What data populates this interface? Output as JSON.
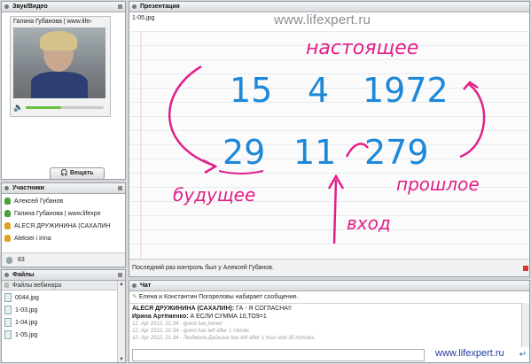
{
  "video_panel": {
    "title": "Звук/Видео",
    "speaker": "Галина Губанова | www.life›",
    "broadcast_label": "Вещать",
    "volume_level": 0.45
  },
  "presentation": {
    "title": "Презентация",
    "file": "1-05.jpg",
    "watermark": "www.lifexpert.ru",
    "status": "Последний раз контроль был у Алексей Губанов.",
    "whiteboard": {
      "nastoyashchee": "настоящее",
      "top_numbers": [
        "15",
        "4",
        "1972"
      ],
      "bottom_numbers": [
        "29",
        "11",
        "279"
      ],
      "budushchee": "будущее",
      "proshloe": "прошлое",
      "vkhod": "вход"
    }
  },
  "participants": {
    "title": "Участники",
    "items": [
      {
        "name": "Алексей Губанов",
        "color": "#4aa23c"
      },
      {
        "name": "Галина Губанова | www.lifexpe",
        "color": "#4aa23c"
      },
      {
        "name": "ALECЯ ДРУЖИНИНА (САХАЛИН",
        "color": "#e0a020"
      },
      {
        "name": "Aleksei i Irina",
        "color": "#e0a020"
      }
    ],
    "count": "83"
  },
  "files": {
    "title": "Файлы",
    "column": "Файлы вебинара",
    "items": [
      "0044.jpg",
      "1-03.jpg",
      "1-04.jpg",
      "1-05.jpg"
    ]
  },
  "chat": {
    "title": "Чат",
    "typing": "Елена и Константин Погореловы набирает сообщение.",
    "messages": [
      {
        "author": "ALECЯ ДРУЖИНИНА (САХАЛИН):",
        "text": " ГА - Я СОГЛАСНА!!",
        "system": false
      },
      {
        "author": "Ирина Артёменко:",
        "text": " А ЕСЛИ СУММА 10,ТО9=1",
        "system": false
      },
      {
        "author": "",
        "text": "12. Apr 2012, 21:34 - guest has joined",
        "system": true
      },
      {
        "author": "",
        "text": "12. Apr 2012, 21:34 - guest has left after 1 minute.",
        "system": true
      },
      {
        "author": "",
        "text": "12. Apr 2012, 21:34 - Людмила Дайкина has left after 1 hour and 35 minutes.",
        "system": true
      }
    ],
    "watermark": "www.lifexpert.ru"
  }
}
